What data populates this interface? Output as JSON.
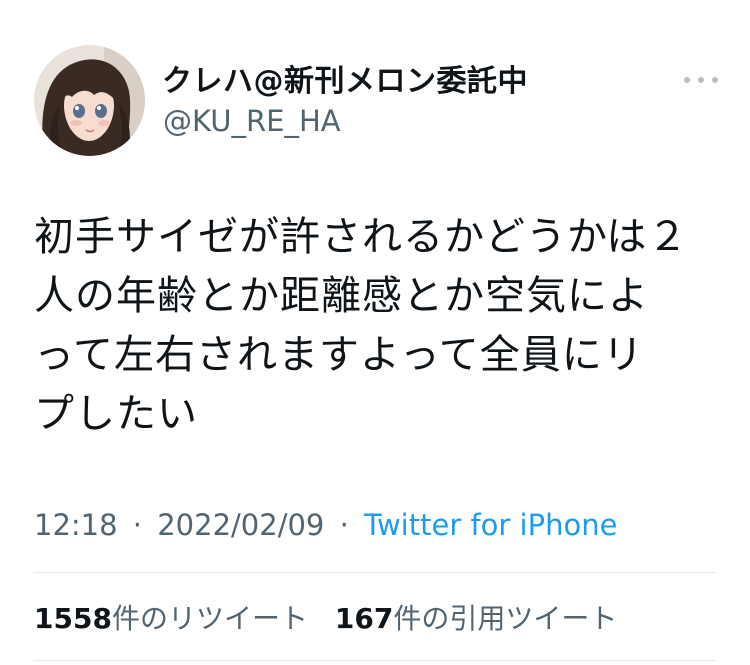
{
  "author": {
    "display_name": "クレハ@新刊メロン委託中",
    "handle": "@KU_RE_HA"
  },
  "icons": {
    "avatar": "anime-avatar",
    "more": "more-dots-icon"
  },
  "tweet": {
    "lines": [
      "初手サイゼが許されるかどうかは２",
      "人の年齢とか距離感とか空気によ",
      "って左右されますよって全員にリ",
      "プしたい"
    ]
  },
  "meta": {
    "time": "12:18",
    "separator": "·",
    "date": "2022/02/09",
    "source": "Twitter for iPhone"
  },
  "stats": {
    "retweets": {
      "count": "1558",
      "label": "件のリツイート"
    },
    "quotes": {
      "count": "167",
      "label": "件の引用ツイート"
    }
  },
  "colors": {
    "text": "#0f1419",
    "secondary": "#536471",
    "link": "#1d9bf0",
    "divider": "#e1e5e8"
  }
}
